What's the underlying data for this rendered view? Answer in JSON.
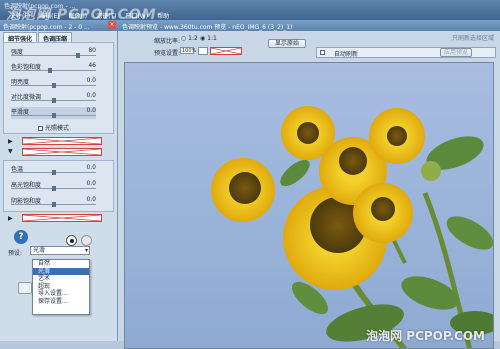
{
  "menubar": {
    "title": "色调映射(pcpop.com - ...",
    "watermark": "泡泡网 PCPOP.COM",
    "items": [
      "文件(F)",
      "编辑(E)",
      "图像(I)",
      "滤镜(T)",
      "窗口(W)",
      "帮助"
    ]
  },
  "panel": {
    "title": "色调映射(pcpop.com - 2 - 0 ...",
    "close": "×",
    "tabs": [
      "细节强化",
      "色调压缩"
    ],
    "sliders1": [
      {
        "label": "强度",
        "value": "80",
        "pos": 0.8
      },
      {
        "label": "色彩饱和度",
        "value": "46",
        "pos": 0.46
      },
      {
        "label": "明亮度",
        "value": "0.0",
        "pos": 0.5
      },
      {
        "label": "对比度微调",
        "value": "0.0",
        "pos": 0.5
      },
      {
        "label": "平滑度",
        "value": "0.0",
        "pos": 0.5
      }
    ],
    "checkbox1": "光照模式",
    "sliders2": [
      {
        "label": "色温",
        "value": "0.0",
        "pos": 0.5
      },
      {
        "label": "高光饱和度",
        "value": "0.0",
        "pos": 0.5
      },
      {
        "label": "阴影饱和度",
        "value": "0.0",
        "pos": 0.5
      }
    ],
    "preset_label": "预设:",
    "preset_value": "光滑",
    "help": "?"
  },
  "dropdown": {
    "options": [
      "自然",
      "光滑",
      "艺术",
      "超现",
      "导入设置...",
      "保存设置..."
    ],
    "selected": 1
  },
  "preview": {
    "title": "色调映射预览 - www.360tu.com 预览 - nEO_IMG_6 (3_2)_1)",
    "zoom_label": "缩放比率:",
    "zoom_opts": [
      "1:2",
      "1:1"
    ],
    "fit_label": "预览设置:",
    "fit_value": "100%",
    "show_original": "显示原始",
    "sync_label": "同步",
    "auto_refresh": "自动刷新",
    "apply": "应用预览",
    "top_right_text": "只刷新选择区域",
    "site_watermark": "泡泡网 PCPOP.COM"
  },
  "colors": {
    "accent": "#5b82ad",
    "red_bar": "#cc4444",
    "sky": "#9fb6d6"
  }
}
